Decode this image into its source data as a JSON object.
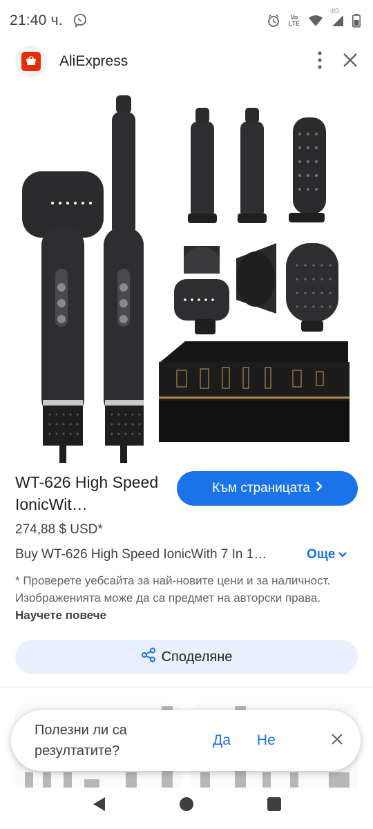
{
  "status_bar": {
    "time": "21:40 ч.",
    "icons": [
      "viber-icon",
      "alarm-icon",
      "volte-icon",
      "wifi-icon",
      "signal-4g-icon",
      "signal-icon",
      "battery-icon"
    ],
    "network_label": "4G",
    "volte_label": "Vo\nLTE"
  },
  "app_header": {
    "title": "AliExpress",
    "logo": "aliexpress-logo",
    "actions": [
      "more-vertical-icon",
      "close-icon"
    ]
  },
  "product": {
    "image": "hair-dryer-set-product-photo",
    "title": "WT-626 High Speed IonicWit…",
    "price": "274,88 $ USD*",
    "description": "Buy WT-626 High Speed IonicWith 7 In 1…",
    "more_label": "Още",
    "disclaimer": "* Проверете уебсайта за най-новите цени и за наличност. Изображенията може да са предмет на авторски права.",
    "learn_more": "Научете повече"
  },
  "actions": {
    "visit_label": "Към страницата",
    "share_label": "Споделяне"
  },
  "feedback": {
    "question": "Полезни ли са резултатите?",
    "yes": "Да",
    "no": "Не"
  },
  "colors": {
    "accent": "#1a73e8",
    "share_bg": "#e8f0fe",
    "brand": "#e62e04"
  }
}
